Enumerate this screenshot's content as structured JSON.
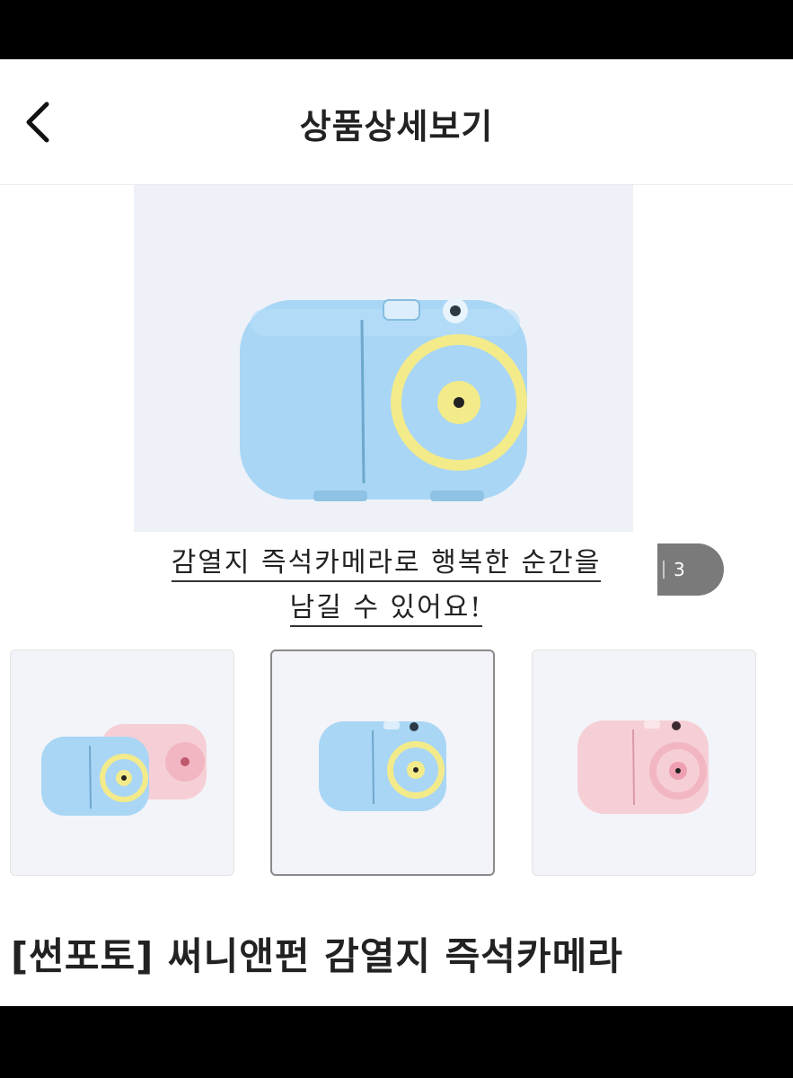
{
  "header": {
    "title": "상품상세보기",
    "back_icon": "chevron-left-icon"
  },
  "hero": {
    "caption_line1": "감열지 즉석카메라로 행복한 순간을",
    "caption_line2": "남길 수 있어요!",
    "page_indicator": "3"
  },
  "thumbnails": [
    {
      "name": "blue-and-pink-cameras",
      "selected": false
    },
    {
      "name": "blue-camera",
      "selected": true
    },
    {
      "name": "pink-camera",
      "selected": false
    }
  ],
  "product": {
    "title": "[썬포토] 써니앤펀 감열지 즉석카메라"
  },
  "colors": {
    "camera_blue": "#a9d6f5",
    "camera_yellow": "#f3ea8a",
    "camera_pink": "#f6cfd6",
    "indicator_gray": "#7a7a7a"
  }
}
